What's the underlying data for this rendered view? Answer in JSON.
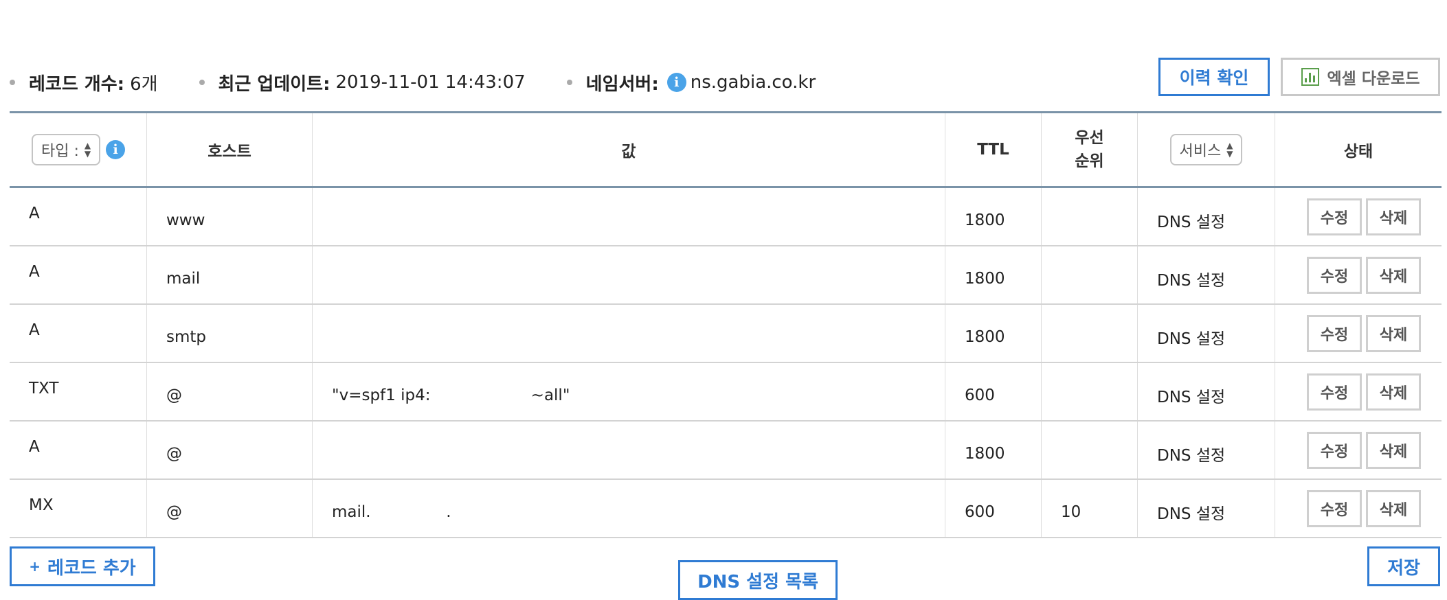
{
  "summary": {
    "record_count_label": "레코드 개수:",
    "record_count_value": "6개",
    "last_update_label": "최근 업데이트:",
    "last_update_value": "2019-11-01 14:43:07",
    "nameserver_label": "네임서버:",
    "nameserver_value": "ns.gabia.co.kr"
  },
  "toolbar": {
    "history_label": "이력 확인",
    "excel_label": "엑셀 다운로드"
  },
  "table": {
    "headers": {
      "type_select": "타입 :",
      "host": "호스트",
      "value": "값",
      "ttl": "TTL",
      "priority_line1": "우선",
      "priority_line2": "순위",
      "service_select": "서비스",
      "status": "상태"
    },
    "rows": [
      {
        "type": "A",
        "host": "www",
        "value": "",
        "ttl": "1800",
        "priority": "",
        "service": "DNS 설정",
        "edit": "수정",
        "delete": "삭제"
      },
      {
        "type": "A",
        "host": "mail",
        "value": "",
        "ttl": "1800",
        "priority": "",
        "service": "DNS 설정",
        "edit": "수정",
        "delete": "삭제"
      },
      {
        "type": "A",
        "host": "smtp",
        "value": "",
        "ttl": "1800",
        "priority": "",
        "service": "DNS 설정",
        "edit": "수정",
        "delete": "삭제"
      },
      {
        "type": "TXT",
        "host": "@",
        "value": "\"v=spf1 ip4:                    ~all\"",
        "ttl": "600",
        "priority": "",
        "service": "DNS 설정",
        "edit": "수정",
        "delete": "삭제"
      },
      {
        "type": "A",
        "host": "@",
        "value": "",
        "ttl": "1800",
        "priority": "",
        "service": "DNS 설정",
        "edit": "수정",
        "delete": "삭제"
      },
      {
        "type": "MX",
        "host": "@",
        "value": "mail.               .",
        "ttl": "600",
        "priority": "10",
        "service": "DNS 설정",
        "edit": "수정",
        "delete": "삭제"
      }
    ]
  },
  "footer": {
    "add_record_label": "레코드 추가",
    "add_record_icon": "+",
    "dns_list_label": "DNS 설정 목록",
    "save_label": "저장"
  },
  "colors": {
    "accent": "#2f7bd3",
    "info": "#4aa3e8",
    "excel_green": "#5a9e4b"
  }
}
